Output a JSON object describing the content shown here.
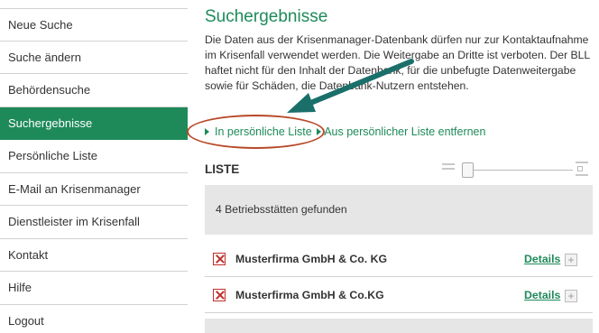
{
  "sidebar": {
    "items": [
      {
        "label": "Neue Suche",
        "active": false
      },
      {
        "label": "Suche ändern",
        "active": false
      },
      {
        "label": "Behördensuche",
        "active": false
      },
      {
        "label": "Suchergebnisse",
        "active": true
      },
      {
        "label": "Persönliche Liste",
        "active": false
      },
      {
        "label": "E-Mail an Krisenmanager",
        "active": false
      },
      {
        "label": "Dienstleister im Krisenfall",
        "active": false
      },
      {
        "label": "Kontakt",
        "active": false
      },
      {
        "label": "Hilfe",
        "active": false
      },
      {
        "label": "Logout",
        "active": false
      }
    ]
  },
  "main": {
    "title": "Suchergebnisse",
    "description": "Die Daten aus der Krisenmanager-Datenbank dürfen nur zur Kontaktaufnahme im Krisenfall verwendet werden. Die Weitergabe an Dritte ist verboten. Der BLL haftet nicht für den Inhalt der Datenbank, für die unbefugte Datenweitergabe sowie für Schäden, die Datenbank-Nutzern entstehen.",
    "actions": {
      "add_to_list": "In persönliche Liste",
      "remove_from_list": "Aus persönlicher Liste entfernen"
    },
    "list": {
      "heading": "LISTE",
      "found_text": "4 Betriebsstätten gefunden",
      "rows": [
        {
          "company": "Musterfirma GmbH & Co. KG",
          "details_label": "Details",
          "expand_symbol": "+"
        },
        {
          "company": "Musterfirma GmbH & Co.KG",
          "details_label": "Details",
          "expand_symbol": "+"
        }
      ]
    }
  },
  "colors": {
    "accent": "#1e8a5a",
    "annotation_ellipse": "#b84a2a",
    "annotation_arrow": "#1a6f6b",
    "remove_icon": "#c0302a",
    "gray_box": "#e6e6e6"
  }
}
